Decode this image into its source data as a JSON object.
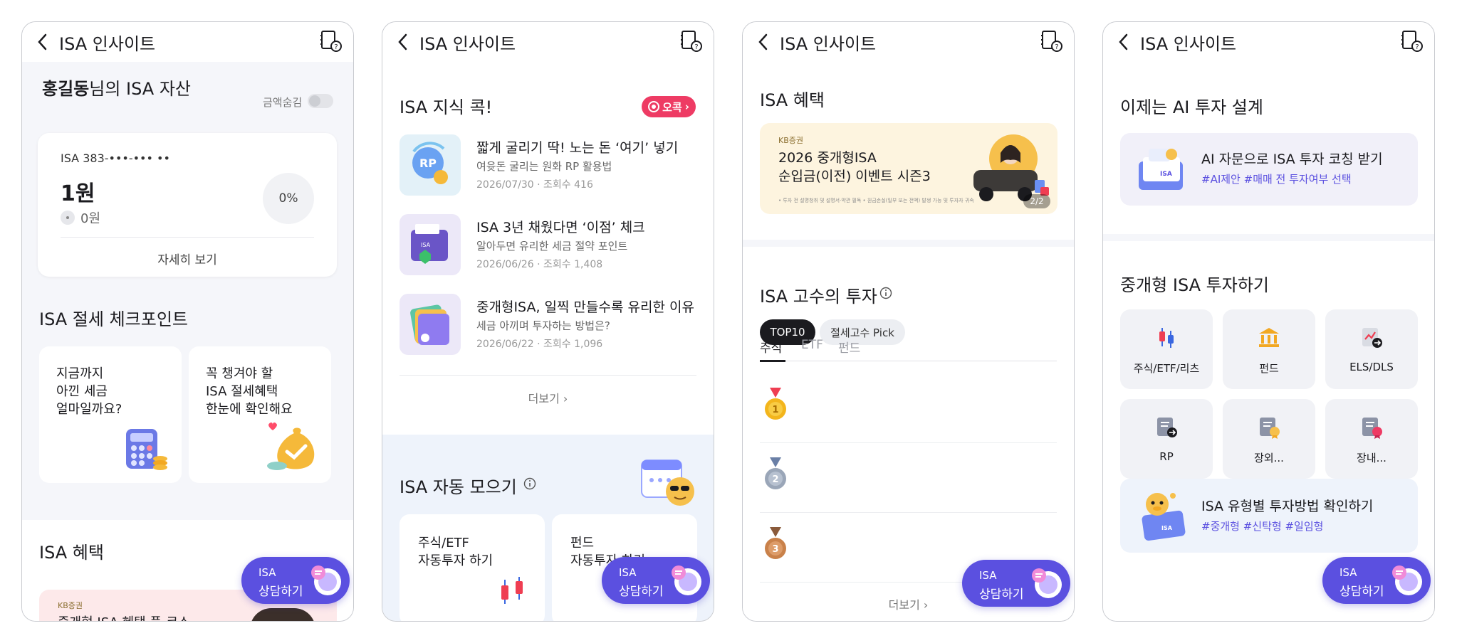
{
  "header_title": "ISA 인사이트",
  "screen1": {
    "asset_name": "홍길동",
    "asset_suffix": "님의 ISA 자산",
    "hide_amount_label": "금액숨김",
    "account_number": "ISA 383-•••-••• ••",
    "amount": "1원",
    "sub_amount": "0원",
    "percent": "0%",
    "detail_link": "자세히 보기",
    "tax_section_title": "ISA 절세 체크포인트",
    "tips": [
      {
        "text": "지금까지\n아낀 세금\n얼마일까요?",
        "icon": "calculator-icon"
      },
      {
        "text": "꼭 챙겨야 할\nISA 절세혜택\n한눈에 확인해요",
        "icon": "money-bag-icon"
      }
    ],
    "benefit_title": "ISA 혜택",
    "banner_brand": "KB증권",
    "banner_title": "중개형 ISA 혜택 풀-코스"
  },
  "screen2": {
    "knowledge_title": "ISA 지식 콕!",
    "badge_label": "오콕",
    "articles": [
      {
        "title": "짧게 굴리기 딱! 노는 돈 ‘여기’ 넣기",
        "subtitle": "여윳돈 굴리는 원화 RP 활용법",
        "meta": "2026/07/30 · 조회수 416"
      },
      {
        "title": "ISA 3년 채웠다면 ‘이점’ 체크",
        "subtitle": "알아두면 유리한 세금 절약 포인트",
        "meta": "2026/06/26 · 조회수 1,408"
      },
      {
        "title": "중개형ISA, 일찍 만들수록 유리한 이유",
        "subtitle": "세금 아끼며 투자하는 방법은?",
        "meta": "2026/06/22 · 조회수 1,096"
      }
    ],
    "more_label": "더보기",
    "auto_title": "ISA 자동 모으기",
    "auto_cards": [
      {
        "text": "주식/ETF\n자동투자 하기"
      },
      {
        "text": "펀드\n자동투자 하기"
      }
    ]
  },
  "screen3": {
    "benefit_title": "ISA 혜택",
    "event_brand": "KB증권",
    "event_line1": "2026 중개형ISA",
    "event_line2": "순입금(이전) 이벤트 시즌3",
    "event_fine": "• 투자 전 설명청취 및 설명서·약관 필독  • 원금손실(일부 또는 전액) 발생 가능 및 투자자 귀속",
    "event_page": "2/2",
    "experts_title": "ISA 고수의 투자",
    "chips": [
      "TOP10",
      "절세고수 Pick"
    ],
    "tabs": [
      "주식",
      "ETF",
      "펀드"
    ],
    "medals": [
      {
        "rank": "1",
        "color": "#f3b51c"
      },
      {
        "rank": "2",
        "color": "#9aa6b8"
      },
      {
        "rank": "3",
        "color": "#c9814a"
      }
    ],
    "more_label": "더보기"
  },
  "screen4": {
    "ai_title": "이제는 AI 투자 설계",
    "ai_card_title": "AI 자문으로 ISA 투자 코칭 받기",
    "ai_card_tags": "#AI제안 #매매 전 투자여부 선택",
    "invest_title": "중개형 ISA 투자하기",
    "grid": [
      {
        "label": "주식/ETF/리츠",
        "icon": "candlestick-icon"
      },
      {
        "label": "펀드",
        "icon": "bank-icon"
      },
      {
        "label": "ELS/DLS",
        "icon": "chart-doc-icon"
      },
      {
        "label": "RP",
        "icon": "document-icon"
      },
      {
        "label": "장외...",
        "icon": "certificate-icon"
      },
      {
        "label": "장내...",
        "icon": "ribbon-doc-icon"
      }
    ],
    "type_card_title": "ISA 유형별 투자방법 확인하기",
    "type_card_tags": "#중개형 #신탁형 #일임형"
  },
  "fab": {
    "line1": "ISA",
    "line2": "상담하기"
  },
  "colors": {
    "accent": "#5b50e0",
    "badge_red": "#ee3b64",
    "event_bg": "#fdf4df"
  }
}
